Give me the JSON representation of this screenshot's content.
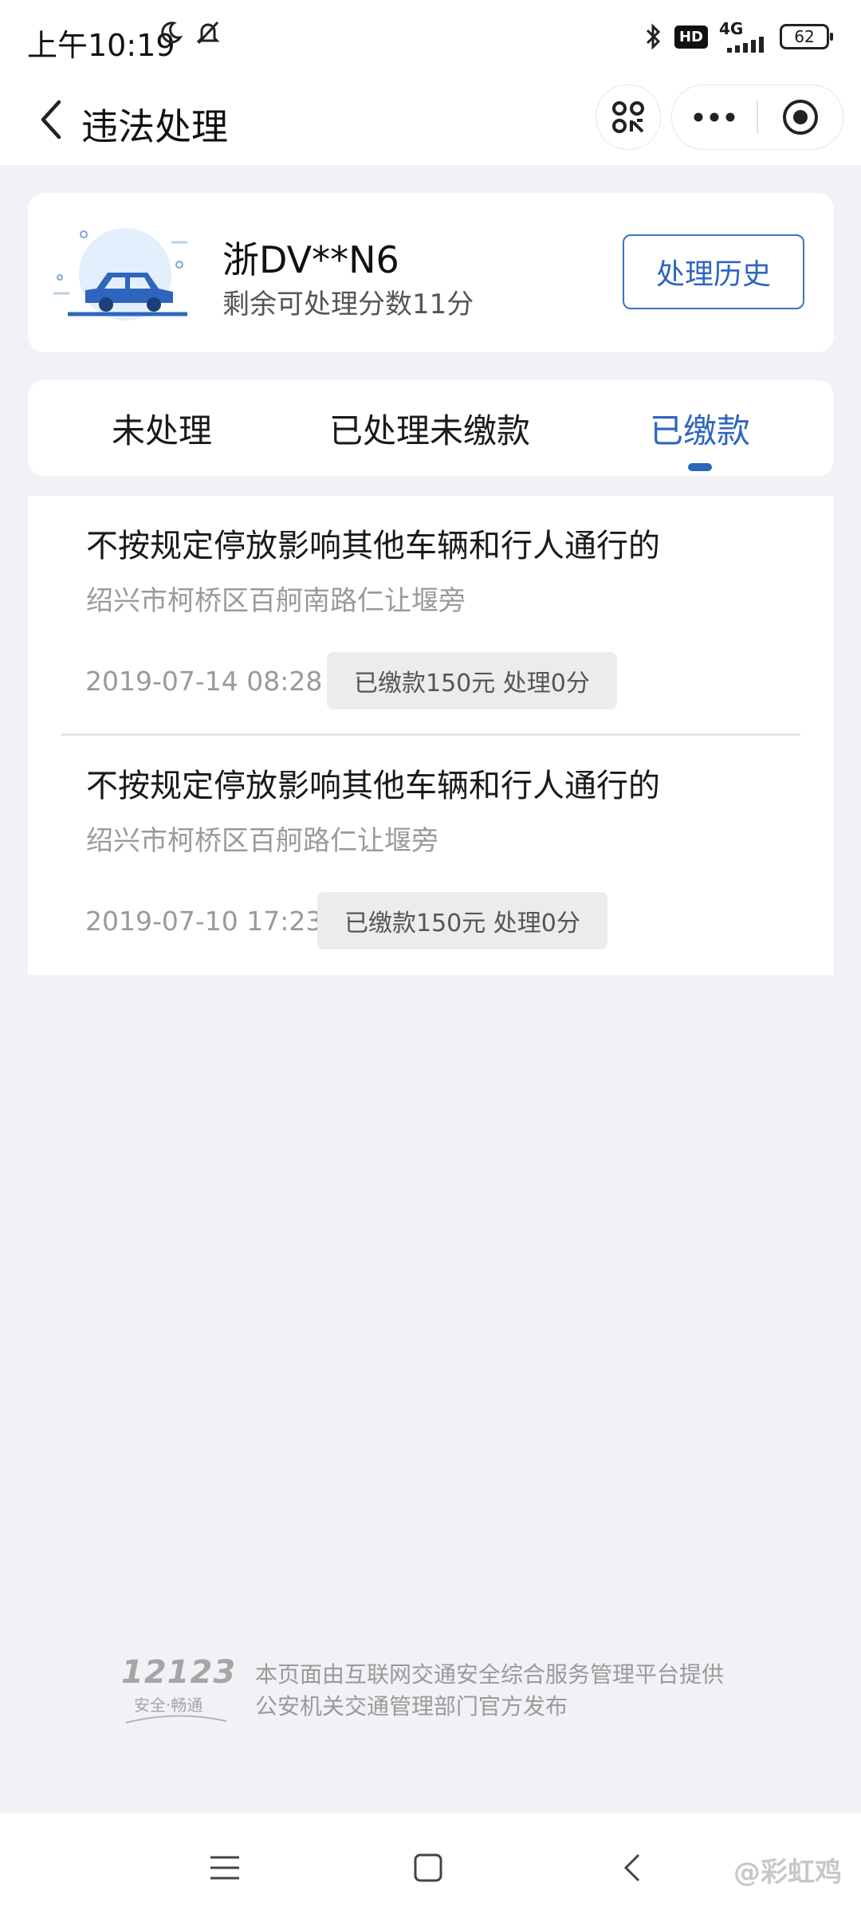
{
  "status_bar": {
    "time": "上午10:19",
    "network": "4G",
    "hd": "HD",
    "battery": "62"
  },
  "header": {
    "title": "违法处理",
    "icons": [
      "back-icon",
      "scan-icon",
      "more-icon",
      "target-icon"
    ]
  },
  "vehicle": {
    "plate": "浙DV**N6",
    "points_text": "剩余可处理分数11分",
    "history_button": "处理历史"
  },
  "tabs": [
    {
      "label": "未处理",
      "active": false
    },
    {
      "label": "已处理未缴款",
      "active": false
    },
    {
      "label": "已缴款",
      "active": true
    }
  ],
  "violations": [
    {
      "title": "不按规定停放影响其他车辆和行人通行的",
      "address": "绍兴市柯桥区百舸南路仁让堰旁",
      "time": "2019-07-14 08:28",
      "status": "已缴款150元  处理0分"
    },
    {
      "title": "不按规定停放影响其他车辆和行人通行的",
      "address": "绍兴市柯桥区百舸路仁让堰旁",
      "time": "2019-07-10 17:23",
      "status": "已缴款150元  处理0分"
    }
  ],
  "footer": {
    "logo_number": "12123",
    "logo_slogan": "安全·畅通",
    "line1": "本页面由互联网交通安全综合服务管理平台提供",
    "line2": "公安机关交通管理部门官方发布"
  },
  "watermark": "@彩虹鸡",
  "colors": {
    "accent": "#2e66bd",
    "background": "#f1f2f6",
    "muted_text": "#9a9a9a"
  }
}
